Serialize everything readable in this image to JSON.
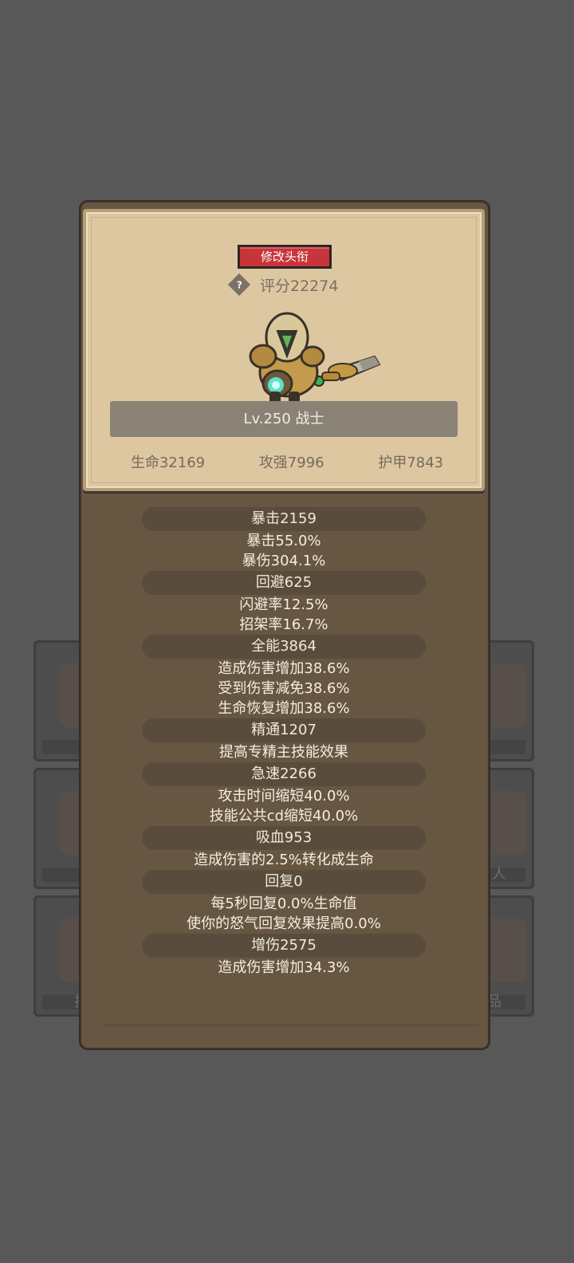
{
  "background_tiles": [
    {
      "label": ""
    },
    {
      "label": ""
    },
    {
      "label": ""
    },
    {
      "label": "人"
    },
    {
      "label": "护"
    },
    {
      "label": "品"
    }
  ],
  "header": {
    "title_button": "修改头衔",
    "help_icon": "?",
    "score": "评分22274"
  },
  "hero": {
    "level_class": "Lv.250 战士"
  },
  "base_stats": {
    "hp": "生命32169",
    "attack": "攻强7996",
    "armor": "护甲7843"
  },
  "stats": [
    {
      "head": "暴击2159",
      "lines": [
        "暴击55.0%",
        "暴伤304.1%"
      ]
    },
    {
      "head": "回避625",
      "lines": [
        "闪避率12.5%",
        "招架率16.7%"
      ]
    },
    {
      "head": "全能3864",
      "lines": [
        "造成伤害增加38.6%",
        "受到伤害减免38.6%",
        "生命恢复增加38.6%"
      ]
    },
    {
      "head": "精通1207",
      "lines": [
        "提高专精主技能效果"
      ]
    },
    {
      "head": "急速2266",
      "lines": [
        "攻击时间缩短40.0%",
        "技能公共cd缩短40.0%"
      ]
    },
    {
      "head": "吸血953",
      "lines": [
        "造成伤害的2.5%转化成生命"
      ]
    },
    {
      "head": "回复0",
      "lines": [
        "每5秒回复0.0%生命值",
        "使你的怒气回复效果提高0.0%"
      ]
    },
    {
      "head": "增伤2575",
      "lines": [
        "造成伤害增加34.3%"
      ]
    }
  ]
}
